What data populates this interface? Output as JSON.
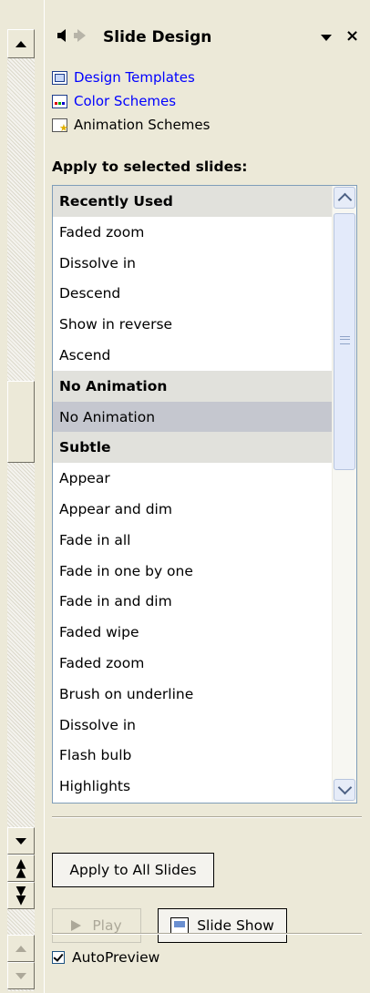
{
  "pane": {
    "title": "Slide Design",
    "links": [
      {
        "label": "Design Templates",
        "icon": "design-templates-icon"
      },
      {
        "label": "Color Schemes",
        "icon": "color-schemes-icon"
      },
      {
        "label": "Animation Schemes",
        "icon": "animation-schemes-icon"
      }
    ],
    "apply_label": "Apply to selected slides:",
    "list": [
      {
        "label": "Recently Used",
        "kind": "header"
      },
      {
        "label": "Faded zoom",
        "kind": "item"
      },
      {
        "label": "Dissolve in",
        "kind": "item"
      },
      {
        "label": "Descend",
        "kind": "item"
      },
      {
        "label": "Show in reverse",
        "kind": "item"
      },
      {
        "label": "Ascend",
        "kind": "item"
      },
      {
        "label": "No Animation",
        "kind": "header"
      },
      {
        "label": "No Animation",
        "kind": "selected"
      },
      {
        "label": "Subtle",
        "kind": "header"
      },
      {
        "label": "Appear",
        "kind": "item"
      },
      {
        "label": "Appear and dim",
        "kind": "item"
      },
      {
        "label": "Fade in all",
        "kind": "item"
      },
      {
        "label": "Fade in one by one",
        "kind": "item"
      },
      {
        "label": "Fade in and dim",
        "kind": "item"
      },
      {
        "label": "Faded wipe",
        "kind": "item"
      },
      {
        "label": "Faded zoom",
        "kind": "item"
      },
      {
        "label": "Brush on underline",
        "kind": "item"
      },
      {
        "label": "Dissolve in",
        "kind": "item"
      },
      {
        "label": "Flash bulb",
        "kind": "item"
      },
      {
        "label": "Highlights",
        "kind": "item"
      }
    ],
    "apply_all_label": "Apply to All Slides",
    "play_label": "Play",
    "slideshow_label": "Slide Show",
    "autopreview_label": "AutoPreview",
    "autopreview_checked": true
  },
  "colors": {
    "link": "#0000ff",
    "header_row": "#e1e1dc",
    "selected_row": "#c5c7cf",
    "background": "#ece9d8"
  }
}
